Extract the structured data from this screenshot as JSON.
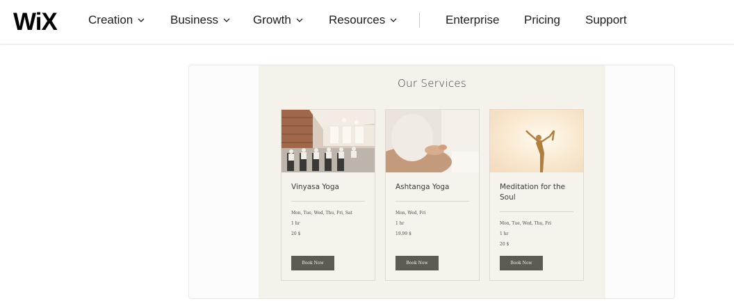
{
  "header": {
    "logo": "WiX",
    "nav": [
      {
        "label": "Creation",
        "dropdown": true
      },
      {
        "label": "Business",
        "dropdown": true
      },
      {
        "label": "Growth",
        "dropdown": true
      },
      {
        "label": "Resources",
        "dropdown": true
      }
    ],
    "secondary_nav": [
      "Enterprise",
      "Pricing",
      "Support"
    ]
  },
  "preview": {
    "title": "Our Services",
    "services": [
      {
        "name": "Vinyasa Yoga",
        "days": "Mon, Tue, Wed, Thu, Fri, Sat",
        "duration": "1 hr",
        "price": "20 $",
        "button": "Book Now",
        "image_icon": "yoga-class-photo"
      },
      {
        "name": "Ashtanga Yoga",
        "days": "Mon, Wed, Fri",
        "duration": "1 hr",
        "price": "19.99 $",
        "button": "Book Now",
        "image_icon": "meditation-hands-photo"
      },
      {
        "name": "Meditation for the Soul",
        "days": "Mon, Tue, Wed, Thu, Fri",
        "duration": "1 hr",
        "price": "20 $",
        "button": "Book Now",
        "image_icon": "dancer-pose-silhouette-photo"
      }
    ]
  },
  "colors": {
    "site_background": "#f5f2ec",
    "button_background": "#5c5a52",
    "text_dark": "#3c3b37"
  }
}
